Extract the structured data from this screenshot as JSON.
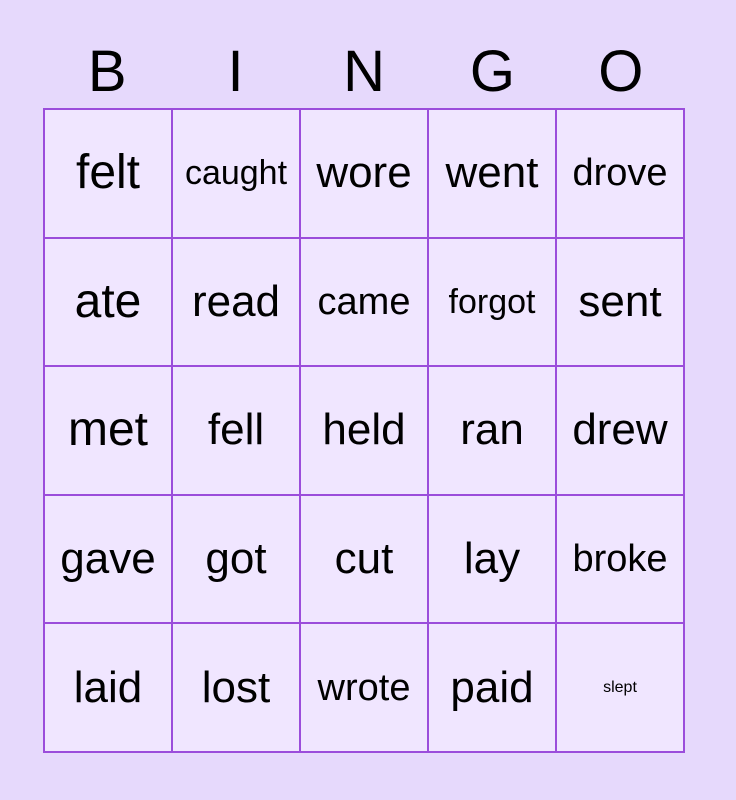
{
  "card": {
    "background_color": "#e6d9fc",
    "cell_background_color": "#f0e6ff",
    "grid_line_color": "#9b4ddb",
    "text_color": "#000000",
    "headers": [
      "B",
      "I",
      "N",
      "G",
      "O"
    ],
    "rows": [
      [
        {
          "text": "felt",
          "size": "fs-48"
        },
        {
          "text": "caught",
          "size": "fs-34"
        },
        {
          "text": "wore",
          "size": "fs-44"
        },
        {
          "text": "went",
          "size": "fs-44"
        },
        {
          "text": "drove",
          "size": "fs-38"
        }
      ],
      [
        {
          "text": "ate",
          "size": "fs-48"
        },
        {
          "text": "read",
          "size": "fs-44"
        },
        {
          "text": "came",
          "size": "fs-38"
        },
        {
          "text": "forgot",
          "size": "fs-34"
        },
        {
          "text": "sent",
          "size": "fs-44"
        }
      ],
      [
        {
          "text": "met",
          "size": "fs-48"
        },
        {
          "text": "fell",
          "size": "fs-44"
        },
        {
          "text": "held",
          "size": "fs-44"
        },
        {
          "text": "ran",
          "size": "fs-44"
        },
        {
          "text": "drew",
          "size": "fs-44"
        }
      ],
      [
        {
          "text": "gave",
          "size": "fs-44"
        },
        {
          "text": "got",
          "size": "fs-44"
        },
        {
          "text": "cut",
          "size": "fs-44"
        },
        {
          "text": "lay",
          "size": "fs-44"
        },
        {
          "text": "broke",
          "size": "fs-38"
        }
      ],
      [
        {
          "text": "laid",
          "size": "fs-44"
        },
        {
          "text": "lost",
          "size": "fs-44"
        },
        {
          "text": "wrote",
          "size": "fs-38"
        },
        {
          "text": "paid",
          "size": "fs-44"
        },
        {
          "text": "slept",
          "size": "fs-40"
        }
      ]
    ]
  }
}
